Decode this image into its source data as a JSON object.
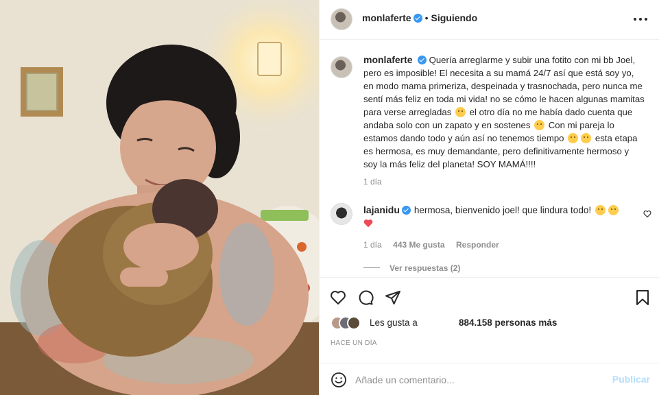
{
  "post": {
    "author": "monlaferte",
    "separator": "•",
    "follow_status": "Siguiendo",
    "caption": "Quería arreglarme y subir una fotito con mi bb Joel, pero es imposible! El necesita a su mamá 24/7 así que está soy yo, en modo mama primeriza, despeinada y trasnochada, pero nunca me sentí más feliz en toda mi vida! no se cómo le hacen algunas mamitas para verse arregladas",
    "caption_part2": "el otro día no me había dado cuenta que andaba solo con un zapato y en sostenes",
    "caption_part3": "Con mi pareja lo estamos dando todo y aún así no tenemos tiempo",
    "caption_part4": "esta etapa es hermosa, es muy demandante, pero definitivamente hermoso y soy la más feliz del planeta! SOY MAMÁ!!!!",
    "caption_age": "1 día"
  },
  "comment": {
    "author": "lajanidu",
    "text": "hermosa, bienvenido joel! que lindura todo!",
    "age": "1 día",
    "likes": "443 Me gusta",
    "reply_label": "Responder",
    "view_replies": "Ver respuestas (2)"
  },
  "likes": {
    "prefix": "Les gusta a",
    "count_text": "884.158 personas más"
  },
  "timestamp": "HACE UN DÍA",
  "composer": {
    "placeholder": "Añade un comentario...",
    "publish_label": "Publicar"
  },
  "colors": {
    "verified": "#3897f0",
    "publish_disabled": "#b2dffc",
    "heart_red": "#ed4956",
    "muted": "#8e8e8e"
  },
  "icons": [
    "more-icon",
    "verified-icon",
    "heart-icon",
    "comment-icon",
    "share-icon",
    "bookmark-icon",
    "emoji-icon"
  ]
}
